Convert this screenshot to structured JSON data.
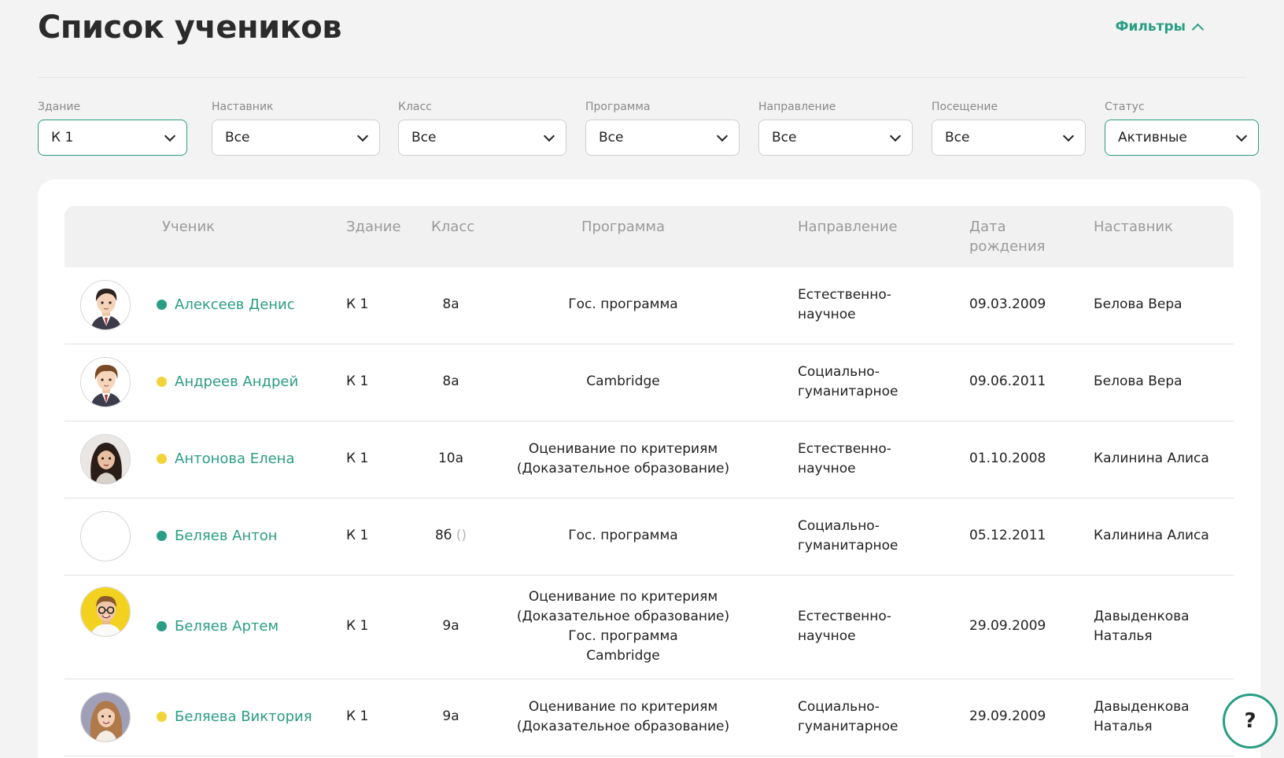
{
  "header": {
    "title": "Список учеников",
    "filters_toggle": "Фильтры"
  },
  "filters": [
    {
      "label": "Здание",
      "value": "К 1"
    },
    {
      "label": "Наставник",
      "value": "Все"
    },
    {
      "label": "Класс",
      "value": "Все"
    },
    {
      "label": "Программа",
      "value": "Все"
    },
    {
      "label": "Направление",
      "value": "Все"
    },
    {
      "label": "Посещение",
      "value": "Все"
    },
    {
      "label": "Статус",
      "value": "Активные"
    }
  ],
  "table": {
    "columns": {
      "student": "Ученик",
      "building": "Здание",
      "class": "Класс",
      "program": "Программа",
      "direction": "Направление",
      "birth_line1": "Дата",
      "birth_line2": "рождения",
      "mentor": "Наставник"
    },
    "rows": [
      {
        "name": "Алексеев Денис",
        "status_color": "#2a9d84",
        "building": "К 1",
        "class": "8а",
        "class_suffix": "",
        "program": [
          "Гос. программа"
        ],
        "direction": [
          "Естественно-",
          "научное"
        ],
        "birth": "09.03.2009",
        "mentor": [
          "Белова Вера"
        ],
        "avatar": "boy-dark-hair-avatar"
      },
      {
        "name": "Андреев Андрей",
        "status_color": "#f2d43a",
        "building": "К 1",
        "class": "8а",
        "class_suffix": "",
        "program": [
          "Cambridge"
        ],
        "direction": [
          "Социально-",
          "гуманитарное"
        ],
        "birth": "09.06.2011",
        "mentor": [
          "Белова Вера"
        ],
        "avatar": "boy-brown-hair-avatar"
      },
      {
        "name": "Антонова Елена",
        "status_color": "#f2d43a",
        "building": "К 1",
        "class": "10а",
        "class_suffix": "",
        "program": [
          "Оценивание по критериям",
          "(Доказательное образование)"
        ],
        "direction": [
          "Естественно-",
          "научное"
        ],
        "birth": "01.10.2008",
        "mentor": [
          "Калинина Алиса"
        ],
        "avatar": "girl-dark-hair-avatar"
      },
      {
        "name": "Беляев Антон",
        "status_color": "#2a9d84",
        "building": "К 1",
        "class": "8б",
        "class_suffix": "()",
        "program": [
          "Гос. программа"
        ],
        "direction": [
          "Социально-",
          "гуманитарное"
        ],
        "birth": "05.12.2011",
        "mentor": [
          "Калинина Алиса"
        ],
        "avatar": "empty-avatar"
      },
      {
        "name": "Беляев Артем",
        "status_color": "#2a9d84",
        "building": "К 1",
        "class": "9а",
        "class_suffix": "",
        "program": [
          "Оценивание по критериям",
          "(Доказательное образование)",
          "Гос. программа",
          "Cambridge"
        ],
        "direction": [
          "Естественно-",
          "научное"
        ],
        "birth": "29.09.2009",
        "mentor": [
          "Давыденкова",
          "Наталья"
        ],
        "avatar": "boy-glasses-avatar"
      },
      {
        "name": "Беляева Виктория",
        "status_color": "#f2d43a",
        "building": "К 1",
        "class": "9а",
        "class_suffix": "",
        "program": [
          "Оценивание по критериям",
          "(Доказательное образование)"
        ],
        "direction": [
          "Социально-",
          "гуманитарное"
        ],
        "birth": "29.09.2009",
        "mentor": [
          "Давыденкова",
          "Наталья"
        ],
        "avatar": "girl-light-hair-avatar"
      }
    ]
  },
  "help_button": "?"
}
